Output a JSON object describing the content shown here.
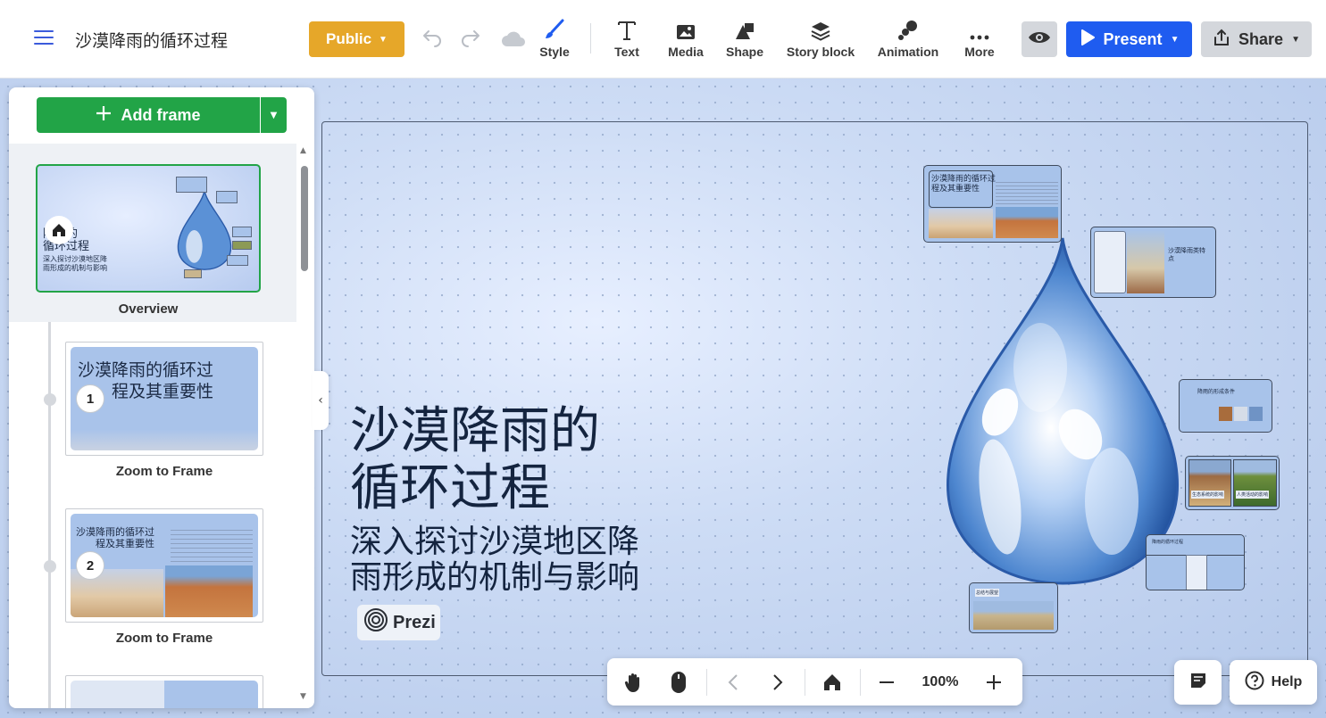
{
  "header": {
    "title": "沙漠降雨的循环过程",
    "public_label": "Public",
    "tools": [
      {
        "label": "Style",
        "icon": "brush-icon"
      },
      {
        "label": "Text",
        "icon": "text-icon"
      },
      {
        "label": "Media",
        "icon": "image-icon"
      },
      {
        "label": "Shape",
        "icon": "shape-icon"
      },
      {
        "label": "Story block",
        "icon": "layers-icon"
      },
      {
        "label": "Animation",
        "icon": "animation-icon"
      },
      {
        "label": "More",
        "icon": "more-icon"
      }
    ],
    "present_label": "Present",
    "share_label": "Share"
  },
  "sidebar": {
    "add_frame_label": "Add frame",
    "overview": {
      "label": "Overview",
      "thumb_title": "降雨的\n循环过程",
      "thumb_sub": "深入探讨沙漠地区降\n雨形成的机制与影响"
    },
    "frames": [
      {
        "number": "1",
        "label": "Zoom to Frame",
        "thumb_title": "沙漠降雨的循环过\n程及其重要性"
      },
      {
        "number": "2",
        "label": "Zoom to Frame",
        "thumb_title": "沙漠降雨的循环过\n程及其重要性"
      }
    ]
  },
  "canvas": {
    "title_line1": "沙漠降雨的",
    "title_line2": "循环过程",
    "subtitle_line1": "深入探讨沙漠地区降",
    "subtitle_line2": "雨形成的机制与影响",
    "prezi_label": "Prezi",
    "cards": {
      "c1": "沙漠降雨的循环过\n程及其重要性",
      "c2": "沙漠降雨类特\n点",
      "c3": "降雨的形成条件",
      "c4a": "生态系统的影响",
      "c4b": "人类活动的影响",
      "c5": "降雨的循环过程",
      "c6": "总结与展望"
    }
  },
  "bottombar": {
    "zoom": "100%"
  },
  "help_label": "Help",
  "colors": {
    "accent_blue": "#1f5cf0",
    "public_orange": "#e6a729",
    "add_green": "#22a447"
  }
}
